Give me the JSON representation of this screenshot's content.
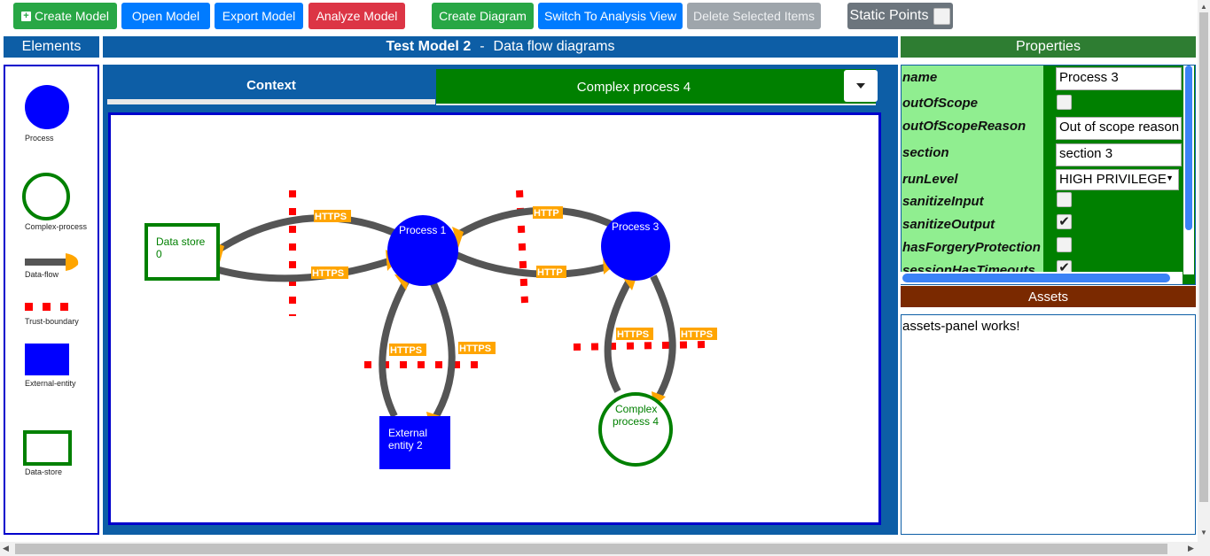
{
  "toolbar": {
    "create_model": "Create Model",
    "open_model": "Open Model",
    "export_model": "Export Model",
    "analyze_model": "Analyze Model",
    "create_diagram": "Create Diagram",
    "switch_view": "Switch To Analysis View",
    "delete_selected": "Delete Selected Items",
    "static_points": "Static Points"
  },
  "headers": {
    "elements": "Elements",
    "model_name": "Test Model 2",
    "separator": "-",
    "diagram_type": "Data flow diagrams",
    "properties": "Properties",
    "assets": "Assets"
  },
  "palette": [
    "Process",
    "Complex-process",
    "Data-flow",
    "Trust-boundary",
    "External-entity",
    "Data-store"
  ],
  "tabs": {
    "context": "Context",
    "complex": "Complex process 4"
  },
  "diagram": {
    "data_store": [
      "Data store",
      "0"
    ],
    "process1": "Process 1",
    "process3": "Process 3",
    "external": [
      "External",
      "entity 2"
    ],
    "complex": [
      "Complex",
      "process 4"
    ],
    "flow_labels": {
      "ds_p1_top": "HTTPS",
      "ds_p1_bottom": "HTTPS",
      "p1_p3_top": "HTTP",
      "p1_p3_bottom": "HTTP",
      "p1_ext_left": "HTTPS",
      "p1_ext_right": "HTTPS",
      "p3_cp_left": "HTTPS",
      "p3_cp_right": "HTTPS"
    }
  },
  "properties": {
    "labels": [
      "name",
      "outOfScope",
      "outOfScopeReason",
      "section",
      "runLevel",
      "sanitizeInput",
      "sanitizeOutput",
      "hasForgeryProtection",
      "sessionHasTimeouts"
    ],
    "name": "Process 3",
    "outOfScopeReason": "Out of scope reason",
    "section": "section 3",
    "runLevel": "HIGH PRIVILEGE",
    "outOfScope": false,
    "sanitizeInput": false,
    "sanitizeOutput": true,
    "hasForgeryProtection": false,
    "sessionHasTimeouts": true
  },
  "assets_text": "assets-panel works!",
  "colors": {
    "primary": "#007bff",
    "success": "#28a745",
    "danger": "#dc3545",
    "secondary": "#6c757d",
    "header_blue": "#0d5ea6",
    "properties_green": "#2e7d32",
    "assets_brown": "#7a2900",
    "process_blue": "#0000ff",
    "store_green": "#008000",
    "flow_gray": "#555555",
    "arrow_orange": "#ffa500",
    "boundary_red": "#ff0000"
  },
  "icons": [
    "plus-square-icon",
    "caret-down-icon",
    "checkbox-icon",
    "checkmark-icon"
  ]
}
